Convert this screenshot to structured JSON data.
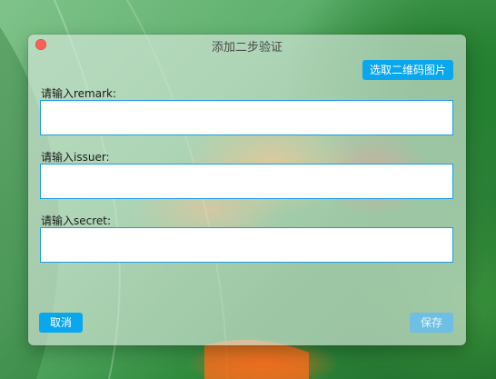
{
  "window": {
    "title": "添加二步验证"
  },
  "toolbar": {
    "qr_label": "选取二维码图片"
  },
  "fields": [
    {
      "label": "请输入remark:",
      "value": ""
    },
    {
      "label": "请输入issuer:",
      "value": ""
    },
    {
      "label": "请输入secret:",
      "value": ""
    }
  ],
  "footer": {
    "cancel_label": "取消",
    "save_label": "保存"
  },
  "colors": {
    "accent": "#0aa7ee",
    "save_disabled": "#6ebfe3",
    "input_border": "#1f9be0",
    "close": "#fc5f57"
  },
  "icons": {
    "close": "close-dot-icon"
  }
}
